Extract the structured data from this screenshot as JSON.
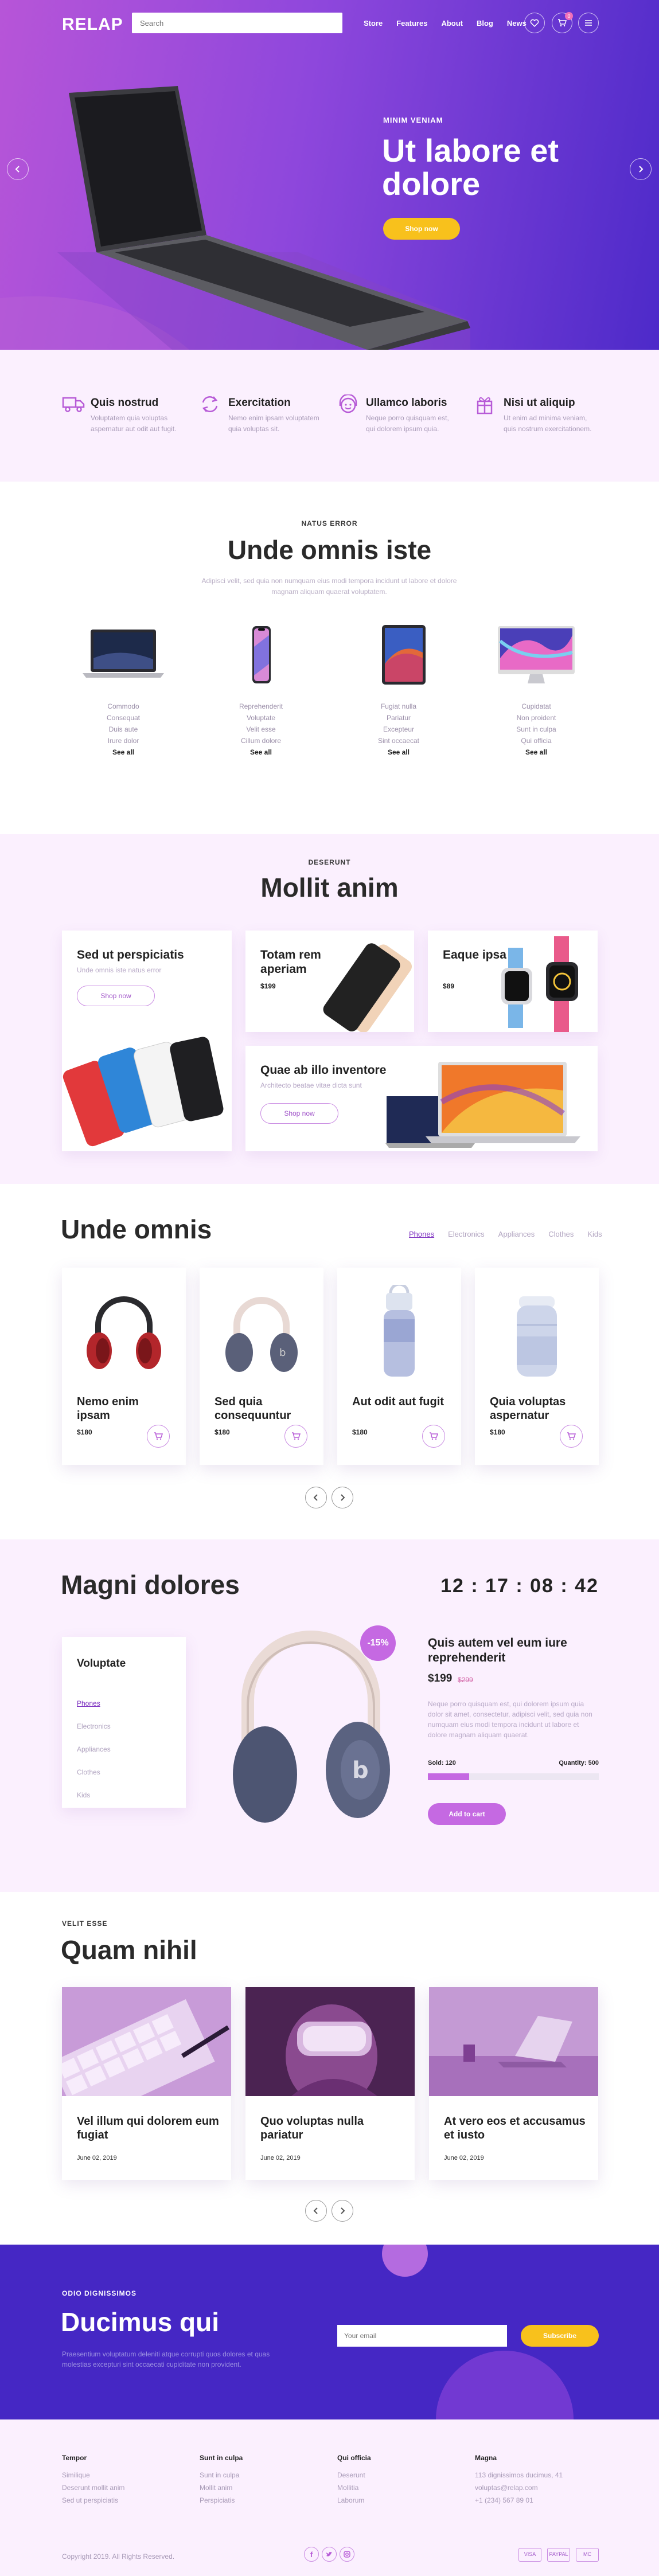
{
  "header": {
    "logo": "RELAP",
    "search_placeholder": "Search",
    "nav": [
      "Store",
      "Features",
      "About",
      "Blog",
      "News"
    ],
    "cart_count": "0"
  },
  "hero": {
    "kicker": "MINIM VENIAM",
    "title": "Ut labore et dolore",
    "button": "Shop now"
  },
  "features": [
    {
      "title": "Quis nostrud",
      "desc": "Voluptatem quia voluptas aspernatur aut odit aut fugit.",
      "icon": "truck-icon"
    },
    {
      "title": "Exercitation",
      "desc": "Nemo enim ipsam voluptatem quia voluptas sit.",
      "icon": "refresh-icon"
    },
    {
      "title": "Ullamco laboris",
      "desc": "Neque porro quisquam est, qui dolorem ipsum quia.",
      "icon": "support-icon"
    },
    {
      "title": "Nisi ut aliquip",
      "desc": "Ut enim ad minima veniam, quis nostrum exercitationem.",
      "icon": "gift-icon"
    }
  ],
  "categories": {
    "kicker": "NATUS ERROR",
    "title": "Unde omnis iste",
    "subtitle": "Adipisci velit, sed quia non numquam eius modi tempora incidunt ut labore et dolore magnam aliquam quaerat voluptatem.",
    "columns": [
      {
        "items": [
          "Commodo",
          "Consequat",
          "Duis aute",
          "Irure dolor"
        ],
        "see_all": "See all"
      },
      {
        "items": [
          "Reprehenderit",
          "Voluptate",
          "Velit esse",
          "Cillum dolore"
        ],
        "see_all": "See all"
      },
      {
        "items": [
          "Fugiat nulla",
          "Pariatur",
          "Excepteur",
          "Sint occaecat"
        ],
        "see_all": "See all"
      },
      {
        "items": [
          "Cupidatat",
          "Non proident",
          "Sunt in culpa",
          "Qui officia"
        ],
        "see_all": "See all"
      }
    ]
  },
  "tiles": {
    "kicker": "DESERUNT",
    "title": "Mollit anim",
    "big": {
      "title": "Sed ut perspiciatis",
      "sub": "Unde omnis iste natus error",
      "button": "Shop now"
    },
    "t2": {
      "title": "Totam rem aperiam",
      "price": "$199"
    },
    "t3": {
      "title": "Eaque ipsa",
      "price": "$89"
    },
    "wide": {
      "title": "Quae ab illo inventore",
      "sub": "Architecto beatae vitae dicta sunt",
      "button": "Shop now"
    }
  },
  "products": {
    "title": "Unde omnis",
    "tabs": [
      "Phones",
      "Electronics",
      "Appliances",
      "Clothes",
      "Kids"
    ],
    "items": [
      {
        "name": "Nemo enim ipsam",
        "price": "$180"
      },
      {
        "name": "Sed quia consequuntur",
        "price": "$180"
      },
      {
        "name": "Aut odit aut fugit",
        "price": "$180"
      },
      {
        "name": "Quia voluptas aspernatur",
        "price": "$180"
      }
    ]
  },
  "deal": {
    "title": "Magni dolores",
    "timer": "12 : 17 : 08 : 42",
    "menu_title": "Voluptate",
    "menu": [
      "Phones",
      "Electronics",
      "Appliances",
      "Clothes",
      "Kids"
    ],
    "discount": "-15%",
    "product_title": "Quis autem vel eum iure reprehenderit",
    "price": "$199",
    "old_price": "$299",
    "desc": "Neque porro quisquam est, qui dolorem ipsum quia dolor sit amet, consectetur, adipisci velit, sed quia non numquam eius modi tempora incidunt ut labore et dolore magnam aliquam quaerat.",
    "sold_label": "Sold: 120",
    "qty_label": "Quantity: 500",
    "sold_fraction": 0.24,
    "button": "Add to cart"
  },
  "blog": {
    "kicker": "VELIT ESSE",
    "title": "Quam nihil",
    "posts": [
      {
        "title": "Vel illum qui dolorem eum fugiat",
        "date": "June 02, 2019"
      },
      {
        "title": "Quo voluptas nulla pariatur",
        "date": "June 02, 2019"
      },
      {
        "title": "At vero eos et accusamus et iusto",
        "date": "June 02, 2019"
      }
    ]
  },
  "newsletter": {
    "kicker": "ODIO DIGNISSIMOS",
    "title": "Ducimus qui",
    "desc": "Praesentium voluptatum deleniti atque corrupti quos dolores et quas molestias excepturi sint occaecati cupiditate non provident.",
    "placeholder": "Your email",
    "button": "Subscribe"
  },
  "footer": {
    "cols": [
      {
        "title": "Tempor",
        "links": [
          "Similique",
          "Deserunt mollit anim",
          "Sed ut perspiciatis"
        ]
      },
      {
        "title": "Sunt in culpa",
        "links": [
          "Sunt in culpa",
          "Mollit anim",
          "Perspiciatis"
        ]
      },
      {
        "title": "Qui officia",
        "links": [
          "Deserunt",
          "Mollitia",
          "Laborum"
        ]
      },
      {
        "title": "Magna",
        "links": [
          "113 dignissimos ducimus, 41",
          "voluptas@relap.com",
          "+1 (234) 567 89 01"
        ]
      }
    ],
    "copyright": "Copyright 2019. All Rights Reserved.",
    "payments": [
      "VISA",
      "PAYPAL",
      "MC"
    ]
  },
  "colors": {
    "accent": "#c569e2",
    "brand_purple": "#4527c4",
    "yellow": "#f8c11c",
    "tint": "#fbf0fe"
  }
}
